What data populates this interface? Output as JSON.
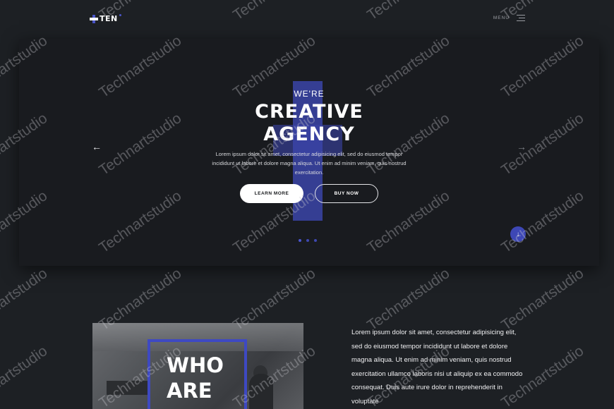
{
  "nav": {
    "logo_text": "TEN",
    "menu_label": "MENU"
  },
  "hero": {
    "eyebrow": "WE'RE",
    "title_line1": "CREATIVE",
    "title_line2": "AGENCY",
    "body": "Lorem ipsum dolor sit amet, consectetur adipisicing elit, sed do eiusmod tempor incididunt ut labore et dolore magna aliqua. Ut enim ad minim veniam, quis nostrud exercitation.",
    "learn_more_label": "LEARN MORE",
    "buy_now_label": "BUY NOW",
    "prev_arrow": "←",
    "next_arrow": "→",
    "scroll_down_arrow": "↓",
    "slides": 3,
    "active_slide": 1
  },
  "about": {
    "heading_line1": "WHO",
    "heading_line2": "ARE",
    "body": "Lorem ipsum dolor sit amet, consectetur adipisicing elit, sed do eiusmod tempor incididunt ut labore et dolore magna aliqua. Ut enim ad minim veniam, quis nostrud exercitation ullamco laboris nisi ut aliquip ex ea commodo consequat. Duis aute irure dolor in reprehenderit in voluptate"
  },
  "watermark": "Technartstudio",
  "colors": {
    "background": "#1d2024",
    "hero_background": "#191b1f",
    "accent": "#3e49c2"
  }
}
